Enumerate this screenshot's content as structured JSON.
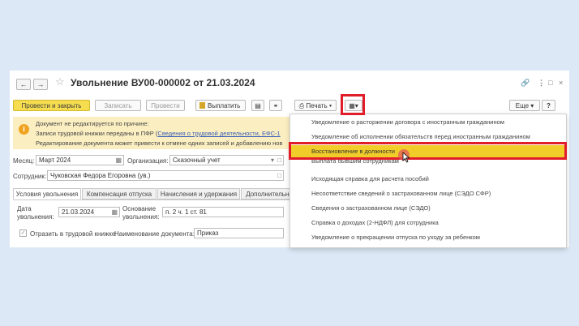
{
  "window": {
    "title": "Увольнение ВУ00-000002 от 21.03.2024",
    "icons": [
      "back-arrow-icon",
      "forward-arrow-icon",
      "star-icon",
      "link-icon",
      "more-icon",
      "close-icon"
    ]
  },
  "toolbar": {
    "post_close": "Провести и закрыть",
    "save": "Записать",
    "post": "Провести",
    "pay": "Выплатить",
    "print": "Печать",
    "more": "Еще",
    "help": "?"
  },
  "notice": {
    "line1": "Документ не редактируется по причине:",
    "line2_prefix": "Записи трудовой книжки переданы в ПФР (",
    "line2_link": "Сведения о трудовой деятельности, ЕФС-1",
    "line3": "Редактирование документа может привести к отмене одних записей и добавлению нов"
  },
  "form": {
    "month_label": "Месяц:",
    "month_value": "Март 2024",
    "org_label": "Организация:",
    "org_value": "Сказочный учет",
    "employee_label": "Сотрудник:",
    "employee_value": "Чуковская Федора Егоровна (ув.)"
  },
  "tabs": [
    "Условия увольнения",
    "Компенсация отпуска",
    "Начисления и удержания",
    "Дополнительно"
  ],
  "conditions": {
    "date_label_1": "Дата",
    "date_label_2": "увольнения:",
    "date_value": "21.03.2024",
    "basis_label_1": "Основание",
    "basis_label_2": "увольнения:",
    "basis_value": "п. 2 ч. 1 ст. 81",
    "reflect_label": "Отразить в трудовой книжке",
    "docname_label": "Наименование документа:",
    "docname_value": "Приказ"
  },
  "menu": {
    "items": [
      "Уведомление о расторжении договора с иностранным гражданином",
      "Уведомление об исполнении обязательств перед иностранным гражданином",
      "Восстановление в должности",
      "Выплата бывшим сотрудникам",
      "Исходящая справка для расчета пособий",
      "Несоответствие сведений о застрахованном лице (СЭДО СФР)",
      "Сведения о застрахованном лице (СЭДО)",
      "Справка о доходах (2-НДФЛ) для сотрудника",
      "Уведомление о прекращении отпуска по уходу за ребенком"
    ],
    "highlighted_index": 2
  },
  "colors": {
    "background": "#dce8f6",
    "primary_button": "#f6dd4f",
    "highlight": "#f1cd2a",
    "notice_bg": "#fbefc2",
    "callout": "#e21d2a",
    "link": "#3a5db5"
  }
}
